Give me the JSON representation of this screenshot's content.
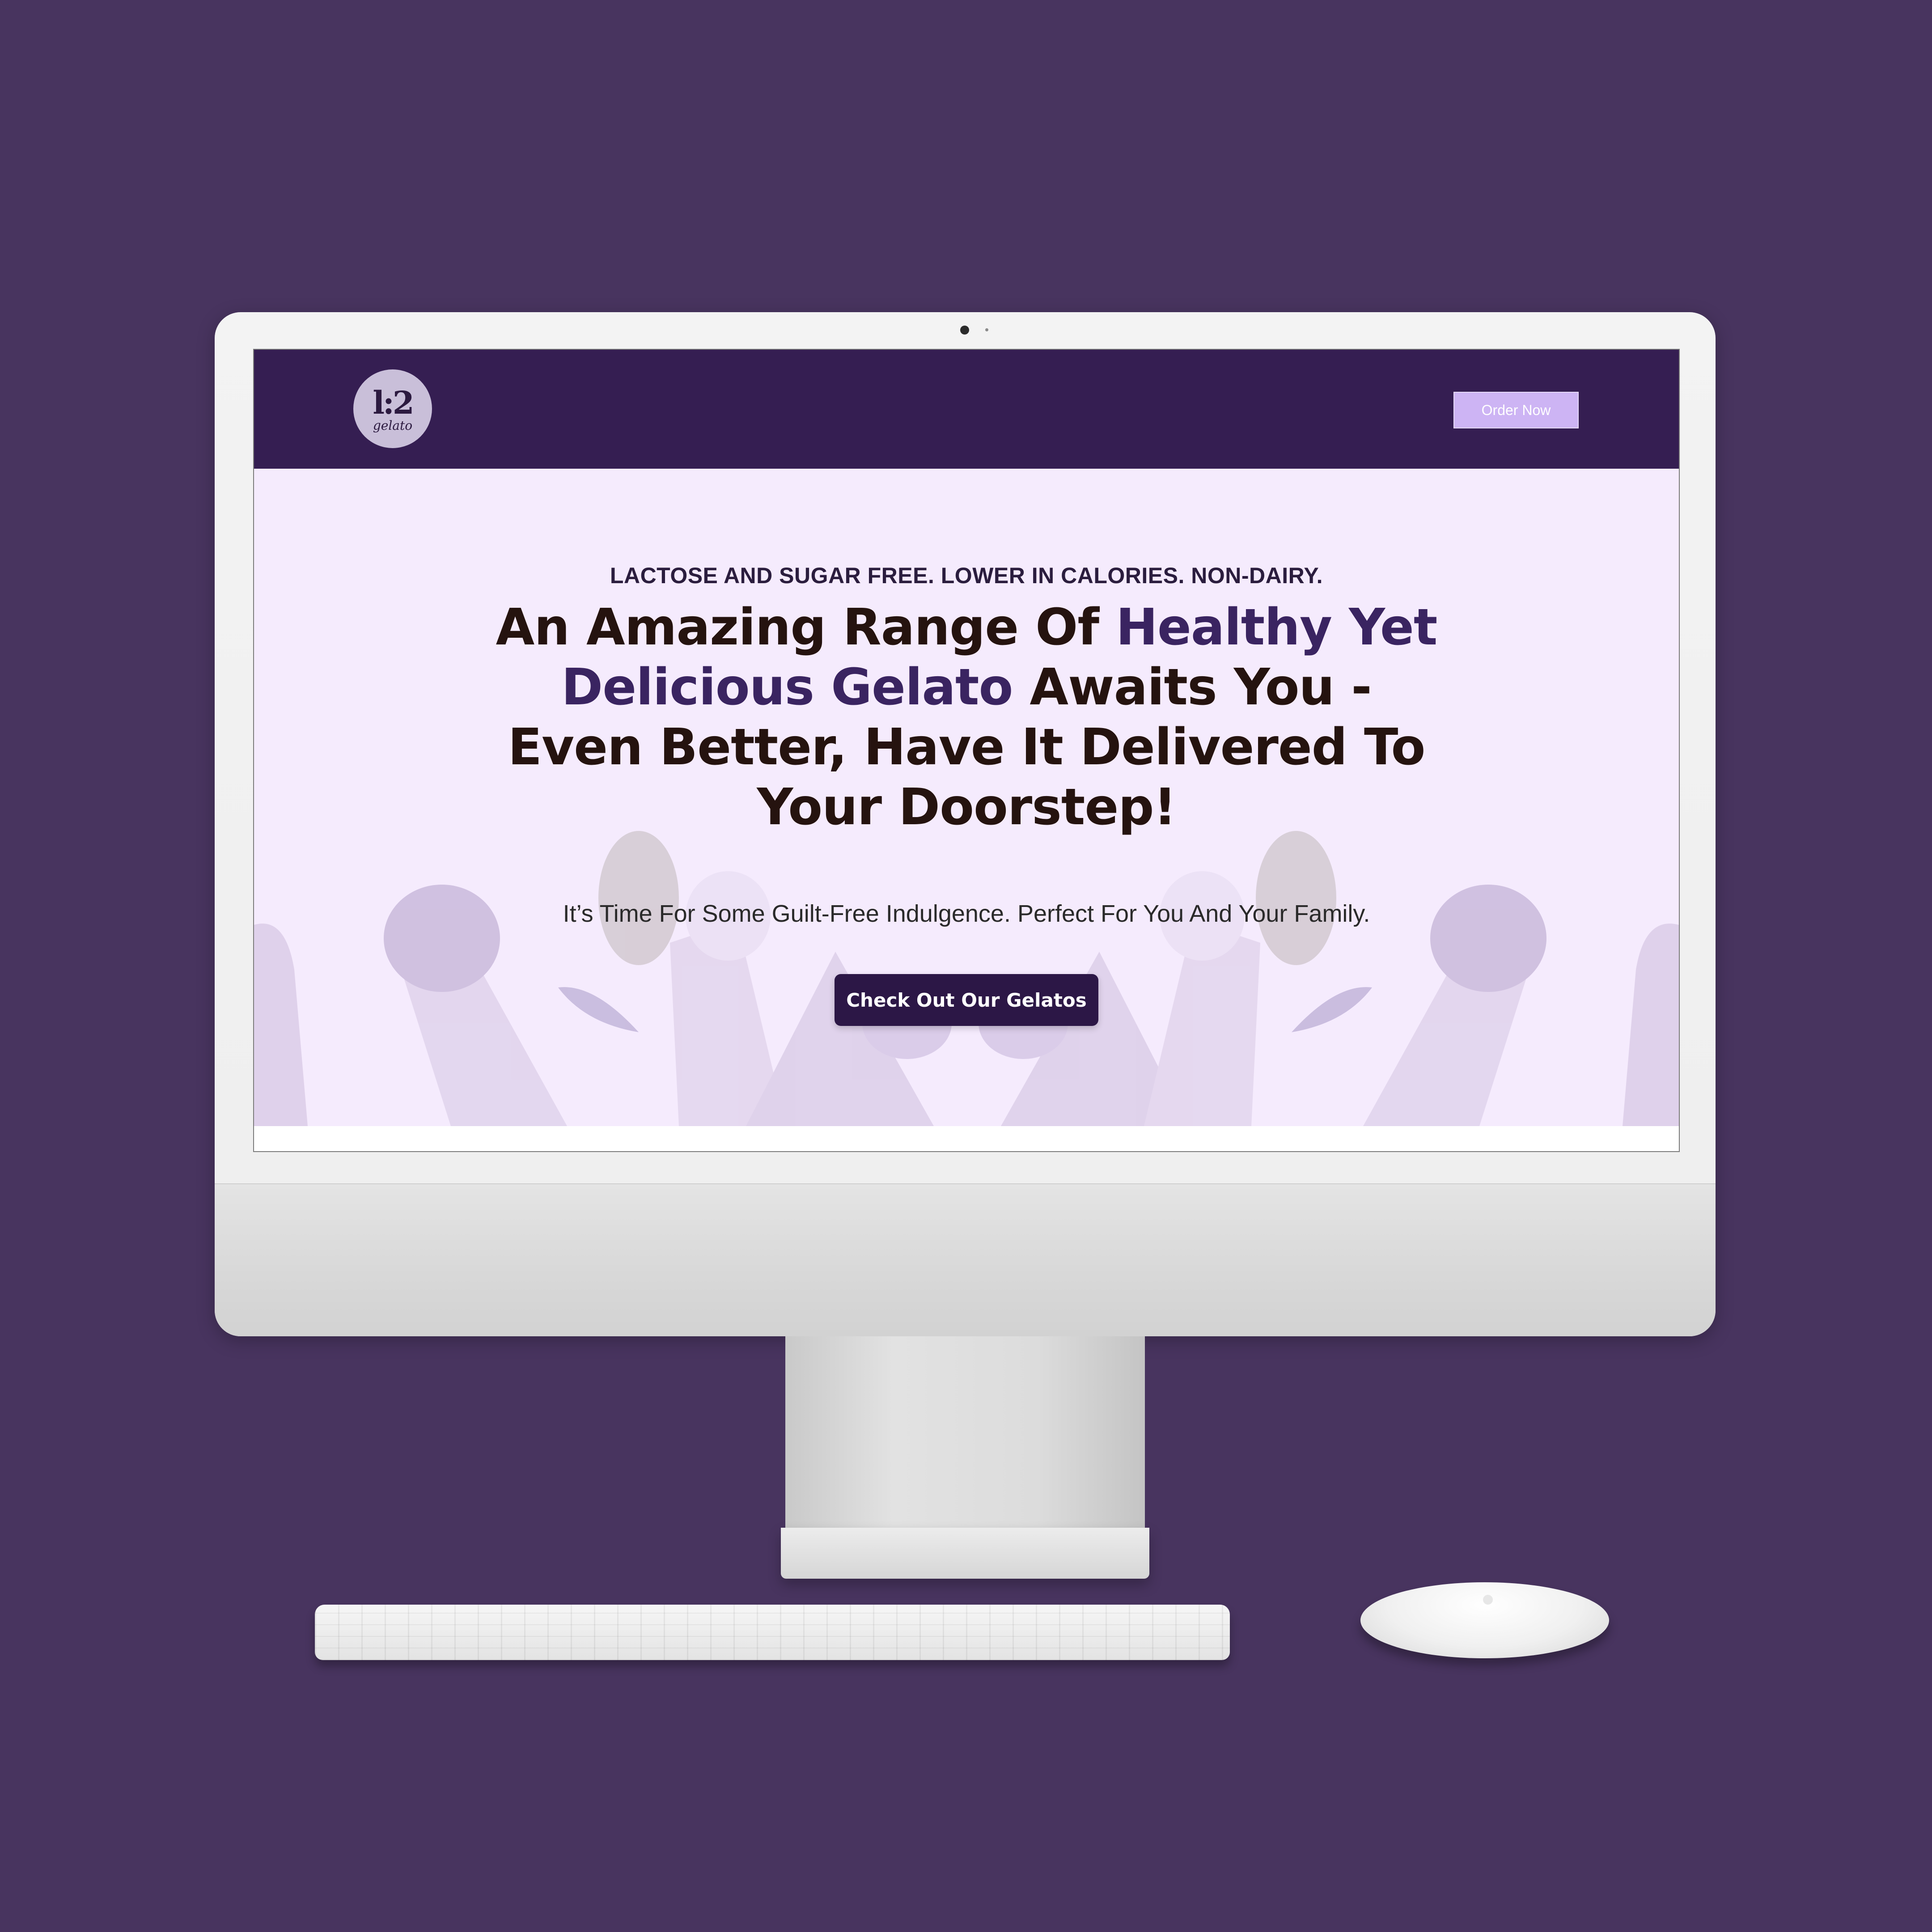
{
  "page": {
    "background_color": "#48345f"
  },
  "site": {
    "header_color": "#351e52",
    "hero_color": "#f5ebfd",
    "logo": {
      "mark": "l:2",
      "word": "gelato"
    },
    "order_button": {
      "label": "Order Now",
      "color": "#cdb4f4"
    },
    "hero": {
      "eyebrow": "LACTOSE AND SUGAR FREE. LOWER IN CALORIES. NON-DAIRY.",
      "title_part1": "An Amazing Range Of ",
      "title_accent": "Healthy Yet Delicious Gelato",
      "title_part2": " Awaits You - Even Better, Have It Delivered To Your Doorstep!",
      "subtitle": "It’s Time For Some Guilt-Free Indulgence. Perfect For You And Your Family.",
      "cta_label": "Check Out Our Gelatos",
      "accent_color": "#3a2461"
    }
  }
}
